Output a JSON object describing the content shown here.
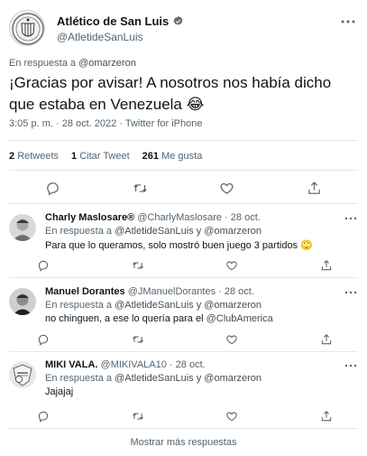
{
  "main_tweet": {
    "author_name": "Atlético de San Luis",
    "author_handle": "@AtletideSanLuis",
    "reply_prefix": "En respuesta a",
    "reply_handle": "@omarzeron",
    "text": "¡Gracias por avisar! A nosotros nos había dicho que estaba en Venezuela 😂",
    "time": "3:05 p. m.",
    "date": "28 oct. 2022",
    "source": "Twitter for iPhone",
    "stats": {
      "retweets_count": "2",
      "retweets_label": "Retweets",
      "quotes_count": "1",
      "quotes_label": "Citar Tweet",
      "likes_count": "261",
      "likes_label": "Me gusta"
    }
  },
  "replies": [
    {
      "name": "Charly Maslosare®",
      "handle": "@CharlyMaslosare",
      "date": "28 oct.",
      "reply_prefix": "En respuesta a",
      "reply_to": "@AtletideSanLuis y @omarzeron",
      "text": "Para que lo queramos, solo mostró buen juego 3 partidos 🙄"
    },
    {
      "name": "Manuel Dorantes",
      "handle": "@JManuelDorantes",
      "date": "28 oct.",
      "reply_prefix": "En respuesta a",
      "reply_to": "@AtletideSanLuis y @omarzeron",
      "text_before": "no chinguen, a ese lo quería para el ",
      "text_link": "@ClubAmerica"
    },
    {
      "name": "MIKI VALA.",
      "handle": "@MIKIVALA10",
      "date": "28 oct.",
      "reply_prefix": "En respuesta a",
      "reply_to": "@AtletideSanLuis y @omarzeron",
      "text": "Jajajaj"
    }
  ],
  "show_more_label": "Mostrar más respuestas",
  "icons": {
    "verified": "verified-badge-icon",
    "more": "more-dots-icon",
    "reply": "reply-icon",
    "retweet": "retweet-icon",
    "like": "heart-icon",
    "share": "share-icon"
  },
  "colors": {
    "text": "#0f1419",
    "secondary": "#536471",
    "divider": "#e6e6e6"
  }
}
